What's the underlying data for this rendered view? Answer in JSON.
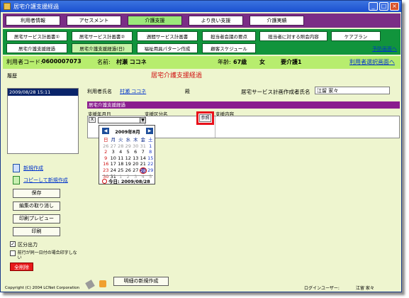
{
  "window": {
    "title": "居宅介護支援経過"
  },
  "menu": {
    "tabs": [
      {
        "label": "利用者情報",
        "active": false
      },
      {
        "label": "アセスメント",
        "active": false
      },
      {
        "label": "介護支援",
        "active": true
      },
      {
        "label": "より良い支援",
        "active": false
      },
      {
        "label": "介護実績",
        "active": false
      }
    ]
  },
  "submenu": {
    "buttons": [
      {
        "label": "居宅サービス計画書①",
        "active": false
      },
      {
        "label": "居宅サービス計画書②",
        "active": false
      },
      {
        "label": "週間サービス計画書",
        "active": false
      },
      {
        "label": "担当者会議の要点",
        "active": false
      },
      {
        "label": "担当者に対する照会内容",
        "active": false
      },
      {
        "label": "ケアプラン",
        "active": false
      },
      {
        "label": "居宅介護支援経過",
        "active": false
      },
      {
        "label": "居宅介護支援経過(日)",
        "active": true
      },
      {
        "label": "福祉用具パターン作成",
        "active": false
      },
      {
        "label": "顧客スケジュール",
        "active": false
      }
    ],
    "yotei_link": "予防画面へ"
  },
  "infobar": {
    "user_code_label": "利用者コード:",
    "user_code": "0600007073",
    "name_label": "名前:",
    "name": "村瀬 ココネ",
    "age_label": "年齢:",
    "age": "67歳",
    "gender": "女",
    "care_level": "要介護1",
    "user_select_link": "利用者選択画面へ"
  },
  "screen_title": "居宅介護支援経過",
  "left": {
    "history_label": "履歴",
    "history_items": [
      "2009/08/28 15:11"
    ],
    "new_create": "新規作成",
    "copy_create": "コピーして新規作成",
    "buttons": {
      "save": "保存",
      "cancel_edit": "編集の取り消し",
      "print_preview": "印刷プレビュー",
      "print": "印刷"
    },
    "checkbox_section_output": "区分出力",
    "checkbox_same_day": "前行が同一日付の場合印字しない",
    "delete_all": "全削除"
  },
  "form": {
    "user_name_label": "利用者氏名",
    "user_name_value": "村瀬 ココネ",
    "honorific": "殿",
    "planner_label": "居宅サービス計画作成者氏名",
    "planner_value": "江留 家々",
    "section_title": "居宅介護支援経過",
    "col_date": "支援年月日",
    "col_category": "支援区分名",
    "col_content": "支援内容",
    "row_marker": "X",
    "reference_button": "参照"
  },
  "calendar": {
    "title": "2009年8月",
    "prev": "◀",
    "next": "▶",
    "weekdays": [
      "日",
      "月",
      "火",
      "水",
      "木",
      "金",
      "土"
    ],
    "weeks": [
      [
        "26",
        "27",
        "28",
        "29",
        "30",
        "31",
        "1"
      ],
      [
        "2",
        "3",
        "4",
        "5",
        "6",
        "7",
        "8"
      ],
      [
        "9",
        "10",
        "11",
        "12",
        "13",
        "14",
        "15"
      ],
      [
        "16",
        "17",
        "18",
        "19",
        "20",
        "21",
        "22"
      ],
      [
        "23",
        "24",
        "25",
        "26",
        "27",
        "28",
        "29"
      ],
      [
        "30",
        "31",
        "1",
        "2",
        "3",
        "4",
        "5"
      ]
    ],
    "today_label": "今日: 2009/08/28"
  },
  "bottom": {
    "copyright": "Copyright (C) 2004 LCNet Corporation",
    "detail_new": "明細の新規作成",
    "login_label": "ログインユーザー:",
    "login_name": "江留 家々"
  },
  "colors": {
    "menu_band": "#7b2d86",
    "green_band": "#11943c",
    "info_band": "#b7ed6e",
    "title_red": "#d01010",
    "highlight": "#e8101a"
  }
}
